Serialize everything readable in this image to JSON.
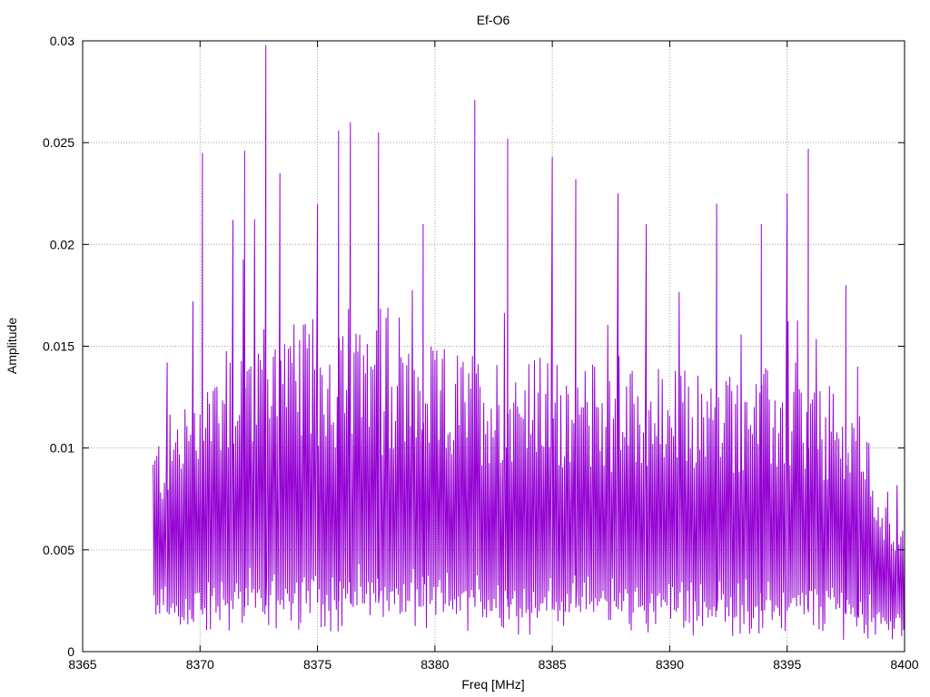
{
  "chart_data": {
    "type": "line",
    "title": "Ef-O6",
    "xlabel": "Freq [MHz]",
    "ylabel": "Amplitude",
    "xlim": [
      8365,
      8400
    ],
    "ylim": [
      0,
      0.03
    ],
    "x_ticks": [
      "8365",
      "8370",
      "8375",
      "8380",
      "8385",
      "8390",
      "8395",
      "8400"
    ],
    "y_ticks": [
      "0",
      "0.005",
      "0.01",
      "0.015",
      "0.02",
      "0.025",
      "0.03"
    ],
    "grid": true,
    "legend": "none",
    "series_color": "#9400d3",
    "series": [
      {
        "x_start": 8368.0,
        "x_end": 8400.0,
        "step": 0.04,
        "envelope": [
          {
            "x": 8368.0,
            "upper_typical": 0.0105,
            "lower_typical": 0.002
          },
          {
            "x": 8370.0,
            "upper_typical": 0.014,
            "lower_typical": 0.0018
          },
          {
            "x": 8372.0,
            "upper_typical": 0.0165,
            "lower_typical": 0.0022
          },
          {
            "x": 8376.0,
            "upper_typical": 0.016,
            "lower_typical": 0.0025
          },
          {
            "x": 8380.0,
            "upper_typical": 0.015,
            "lower_typical": 0.0022
          },
          {
            "x": 8385.0,
            "upper_typical": 0.0145,
            "lower_typical": 0.0022
          },
          {
            "x": 8390.0,
            "upper_typical": 0.014,
            "lower_typical": 0.002
          },
          {
            "x": 8395.0,
            "upper_typical": 0.014,
            "lower_typical": 0.002
          },
          {
            "x": 8398.0,
            "upper_typical": 0.012,
            "lower_typical": 0.0018
          },
          {
            "x": 8400.0,
            "upper_typical": 0.006,
            "lower_typical": 0.001
          }
        ],
        "peaks": [
          {
            "x": 8368.6,
            "y": 0.0142
          },
          {
            "x": 8369.7,
            "y": 0.0172
          },
          {
            "x": 8370.1,
            "y": 0.0245
          },
          {
            "x": 8371.4,
            "y": 0.0212
          },
          {
            "x": 8371.9,
            "y": 0.0246
          },
          {
            "x": 8372.8,
            "y": 0.0298
          },
          {
            "x": 8373.4,
            "y": 0.0235
          },
          {
            "x": 8375.0,
            "y": 0.022
          },
          {
            "x": 8375.9,
            "y": 0.0256
          },
          {
            "x": 8376.4,
            "y": 0.026
          },
          {
            "x": 8377.6,
            "y": 0.0255
          },
          {
            "x": 8379.5,
            "y": 0.021
          },
          {
            "x": 8381.7,
            "y": 0.0271
          },
          {
            "x": 8383.1,
            "y": 0.0252
          },
          {
            "x": 8385.0,
            "y": 0.0243
          },
          {
            "x": 8386.0,
            "y": 0.0232
          },
          {
            "x": 8387.8,
            "y": 0.0225
          },
          {
            "x": 8389.0,
            "y": 0.021
          },
          {
            "x": 8392.0,
            "y": 0.022
          },
          {
            "x": 8393.9,
            "y": 0.021
          },
          {
            "x": 8395.0,
            "y": 0.0225
          },
          {
            "x": 8395.9,
            "y": 0.0247
          },
          {
            "x": 8397.5,
            "y": 0.018
          },
          {
            "x": 8398.0,
            "y": 0.014
          }
        ]
      }
    ]
  }
}
